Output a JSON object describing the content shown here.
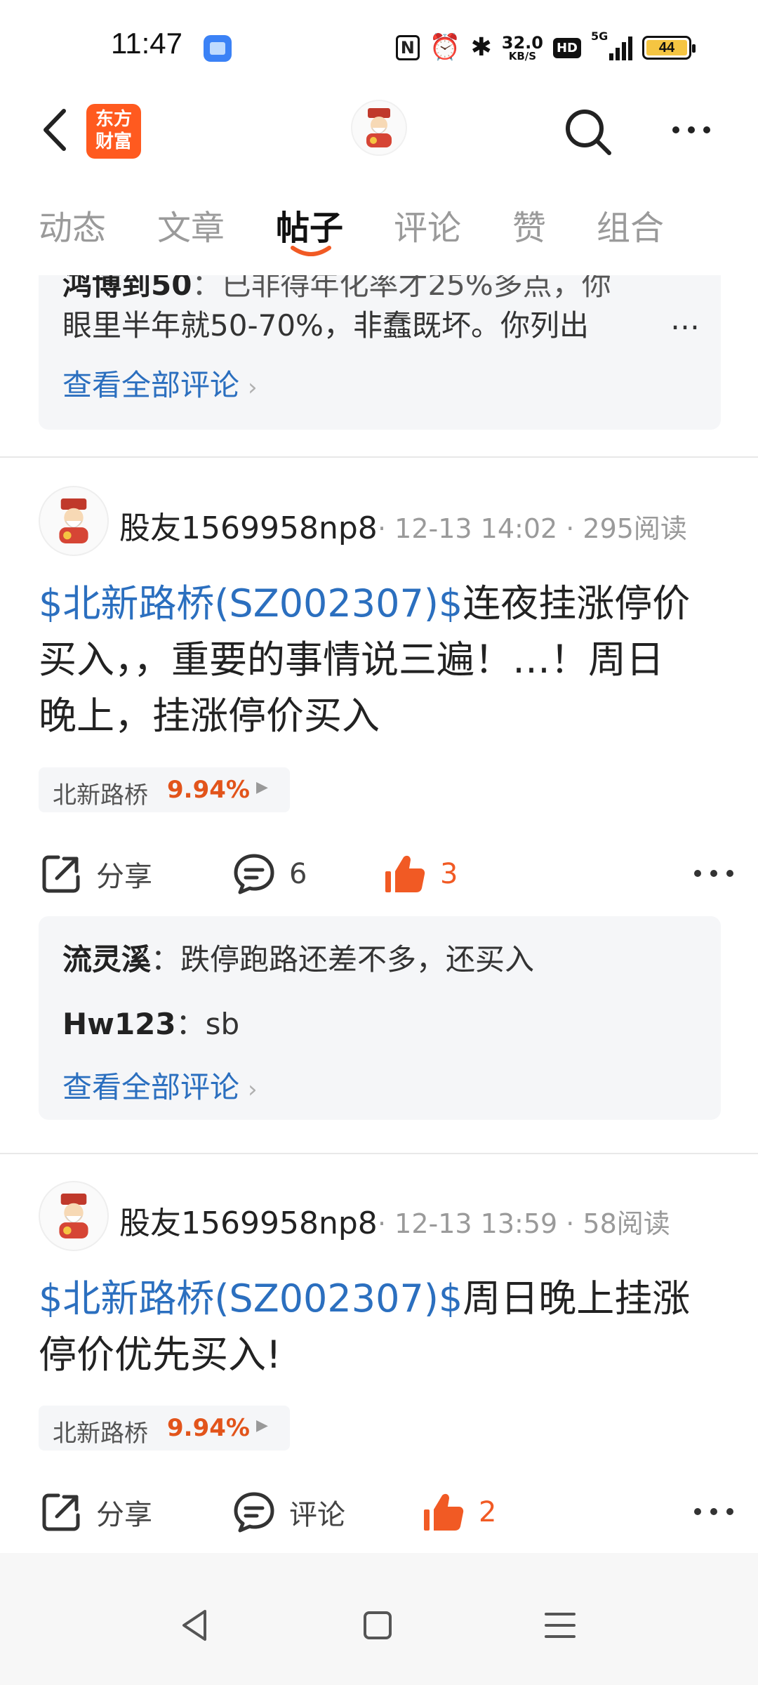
{
  "status_bar": {
    "time": "11:47",
    "net_speed_value": "32.0",
    "net_speed_unit": "KB/S",
    "hd_label": "HD",
    "network_label": "5G",
    "battery": "44"
  },
  "nav": {
    "brand_line1": "东方",
    "brand_line2": "财富"
  },
  "tabs": [
    {
      "label": "动态"
    },
    {
      "label": "文章"
    },
    {
      "label": "帖子"
    },
    {
      "label": "评论"
    },
    {
      "label": "赞"
    },
    {
      "label": "组合"
    }
  ],
  "top_fragment": {
    "partial_line_user": "鸿博到50",
    "partial_line_text": "：已非得年化率才25%多点，你",
    "line2": "眼里半年就50-70%，非蠢既坏。你列出",
    "ellipsis": "…",
    "view_all": "查看全部评论"
  },
  "posts": [
    {
      "user": "股友1569958np8",
      "meta": "· 12-13 14:02 · 295阅读",
      "stock_link": "$北新路桥(SZ002307)$",
      "text_line1": "连夜挂涨停价",
      "text_line2": "买入，，重要的事情说三遍！…！周日",
      "text_line3": "晚上，挂涨停价买入",
      "chip_name": "北新路桥",
      "chip_pct": "9.94%",
      "share_label": "分享",
      "comment_label": "6",
      "like_count": "3",
      "comments": [
        {
          "user": "流灵溪",
          "text": "：跌停跑路还差不多，还买入"
        },
        {
          "user": "Hw123",
          "text": "：sb"
        }
      ],
      "view_all": "查看全部评论"
    },
    {
      "user": "股友1569958np8",
      "meta": "· 12-13 13:59 · 58阅读",
      "stock_link": "$北新路桥(SZ002307)$",
      "text_line1": "周日晚上挂涨",
      "text_line2": "停价优先买入!",
      "chip_name": "北新路桥",
      "chip_pct": "9.94%",
      "share_label": "分享",
      "comment_label": "评论",
      "like_count": "2"
    }
  ],
  "colors": {
    "accent_blue": "#2b6fbf",
    "like_orange": "#f15a24",
    "brand_orange": "#ff5a1f",
    "pct_red": "#e2541b"
  }
}
